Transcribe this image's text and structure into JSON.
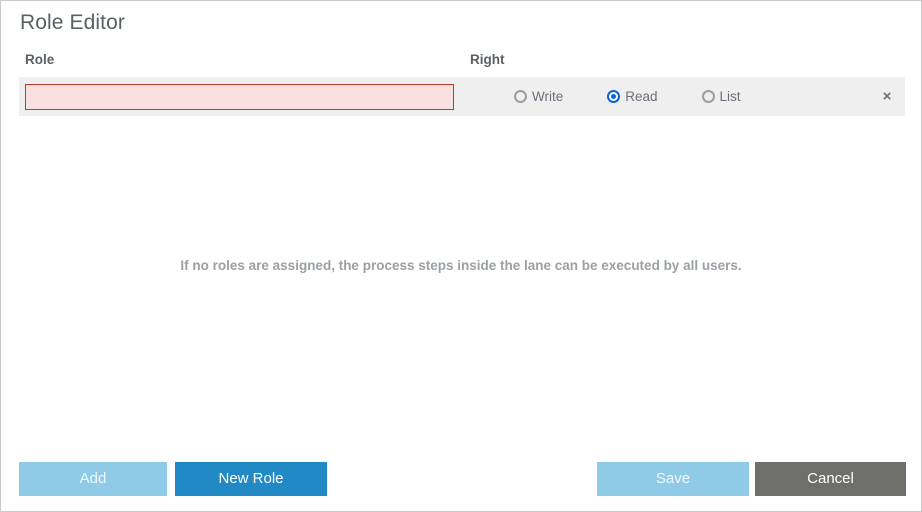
{
  "dialog": {
    "title": "Role Editor",
    "hint": "If no roles are assigned, the process steps inside the lane can be executed by all users."
  },
  "columns": {
    "role_header": "Role",
    "right_header": "Right"
  },
  "role_rows": [
    {
      "role_value": "",
      "role_placeholder": "",
      "invalid": true,
      "rights": [
        {
          "label": "Write",
          "checked": false
        },
        {
          "label": "Read",
          "checked": true
        },
        {
          "label": "List",
          "checked": false
        }
      ],
      "remove_icon": "×"
    }
  ],
  "footer": {
    "add_label": "Add",
    "new_role_label": "New Role",
    "save_label": "Save",
    "cancel_label": "Cancel"
  },
  "colors": {
    "primary_blue": "#2189c4",
    "disabled_blue": "#8fcae7",
    "cancel_gray": "#6e6e6b",
    "row_gray": "#efefef",
    "error_border": "#c0392b",
    "error_fill": "#fae0e0",
    "radio_selected": "#0b63d6",
    "title_gray": "#5b6066",
    "hint_gray": "#9b9fa6"
  }
}
